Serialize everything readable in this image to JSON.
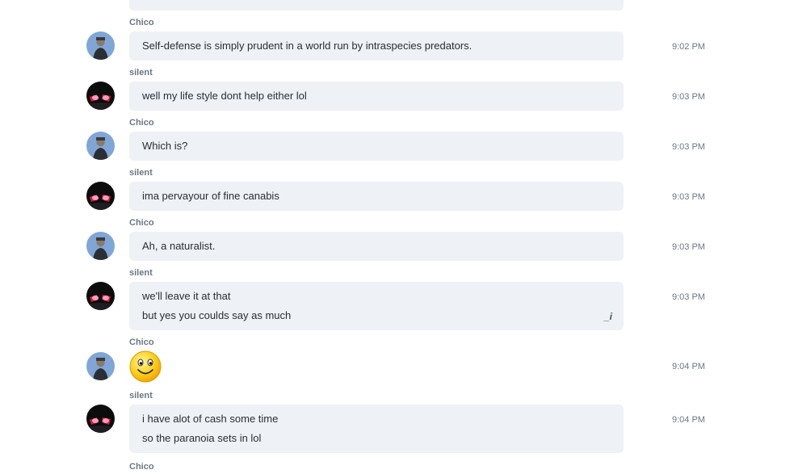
{
  "messages": [
    {
      "sender": "Chico",
      "lines": [
        "Self-defense is simply prudent in a world run by intraspecies predators."
      ],
      "time": "9:02 PM"
    },
    {
      "sender": "silent",
      "lines": [
        "well my life style dont help either lol"
      ],
      "time": "9:03 PM"
    },
    {
      "sender": "Chico",
      "lines": [
        "Which is?"
      ],
      "time": "9:03 PM"
    },
    {
      "sender": "silent",
      "lines": [
        "ima pervayour of fine canabis"
      ],
      "time": "9:03 PM"
    },
    {
      "sender": "Chico",
      "lines": [
        "Ah, a naturalist."
      ],
      "time": "9:03 PM"
    },
    {
      "sender": "silent",
      "lines": [
        "we'll leave it at that",
        "but yes you coulds say as much"
      ],
      "time": "9:03 PM",
      "edited_mark": "_i"
    },
    {
      "sender": "Chico",
      "emoji": "smiley-emoji",
      "time": "9:04 PM"
    },
    {
      "sender": "silent",
      "lines": [
        "i have alot of cash some time",
        "so the paranoia sets in lol"
      ],
      "time": "9:04 PM"
    }
  ],
  "next_sender_partial": "Chico",
  "colors": {
    "bubble": "#eef1f6",
    "meta_text": "#6b7785",
    "message_text": "#2a2f35"
  }
}
